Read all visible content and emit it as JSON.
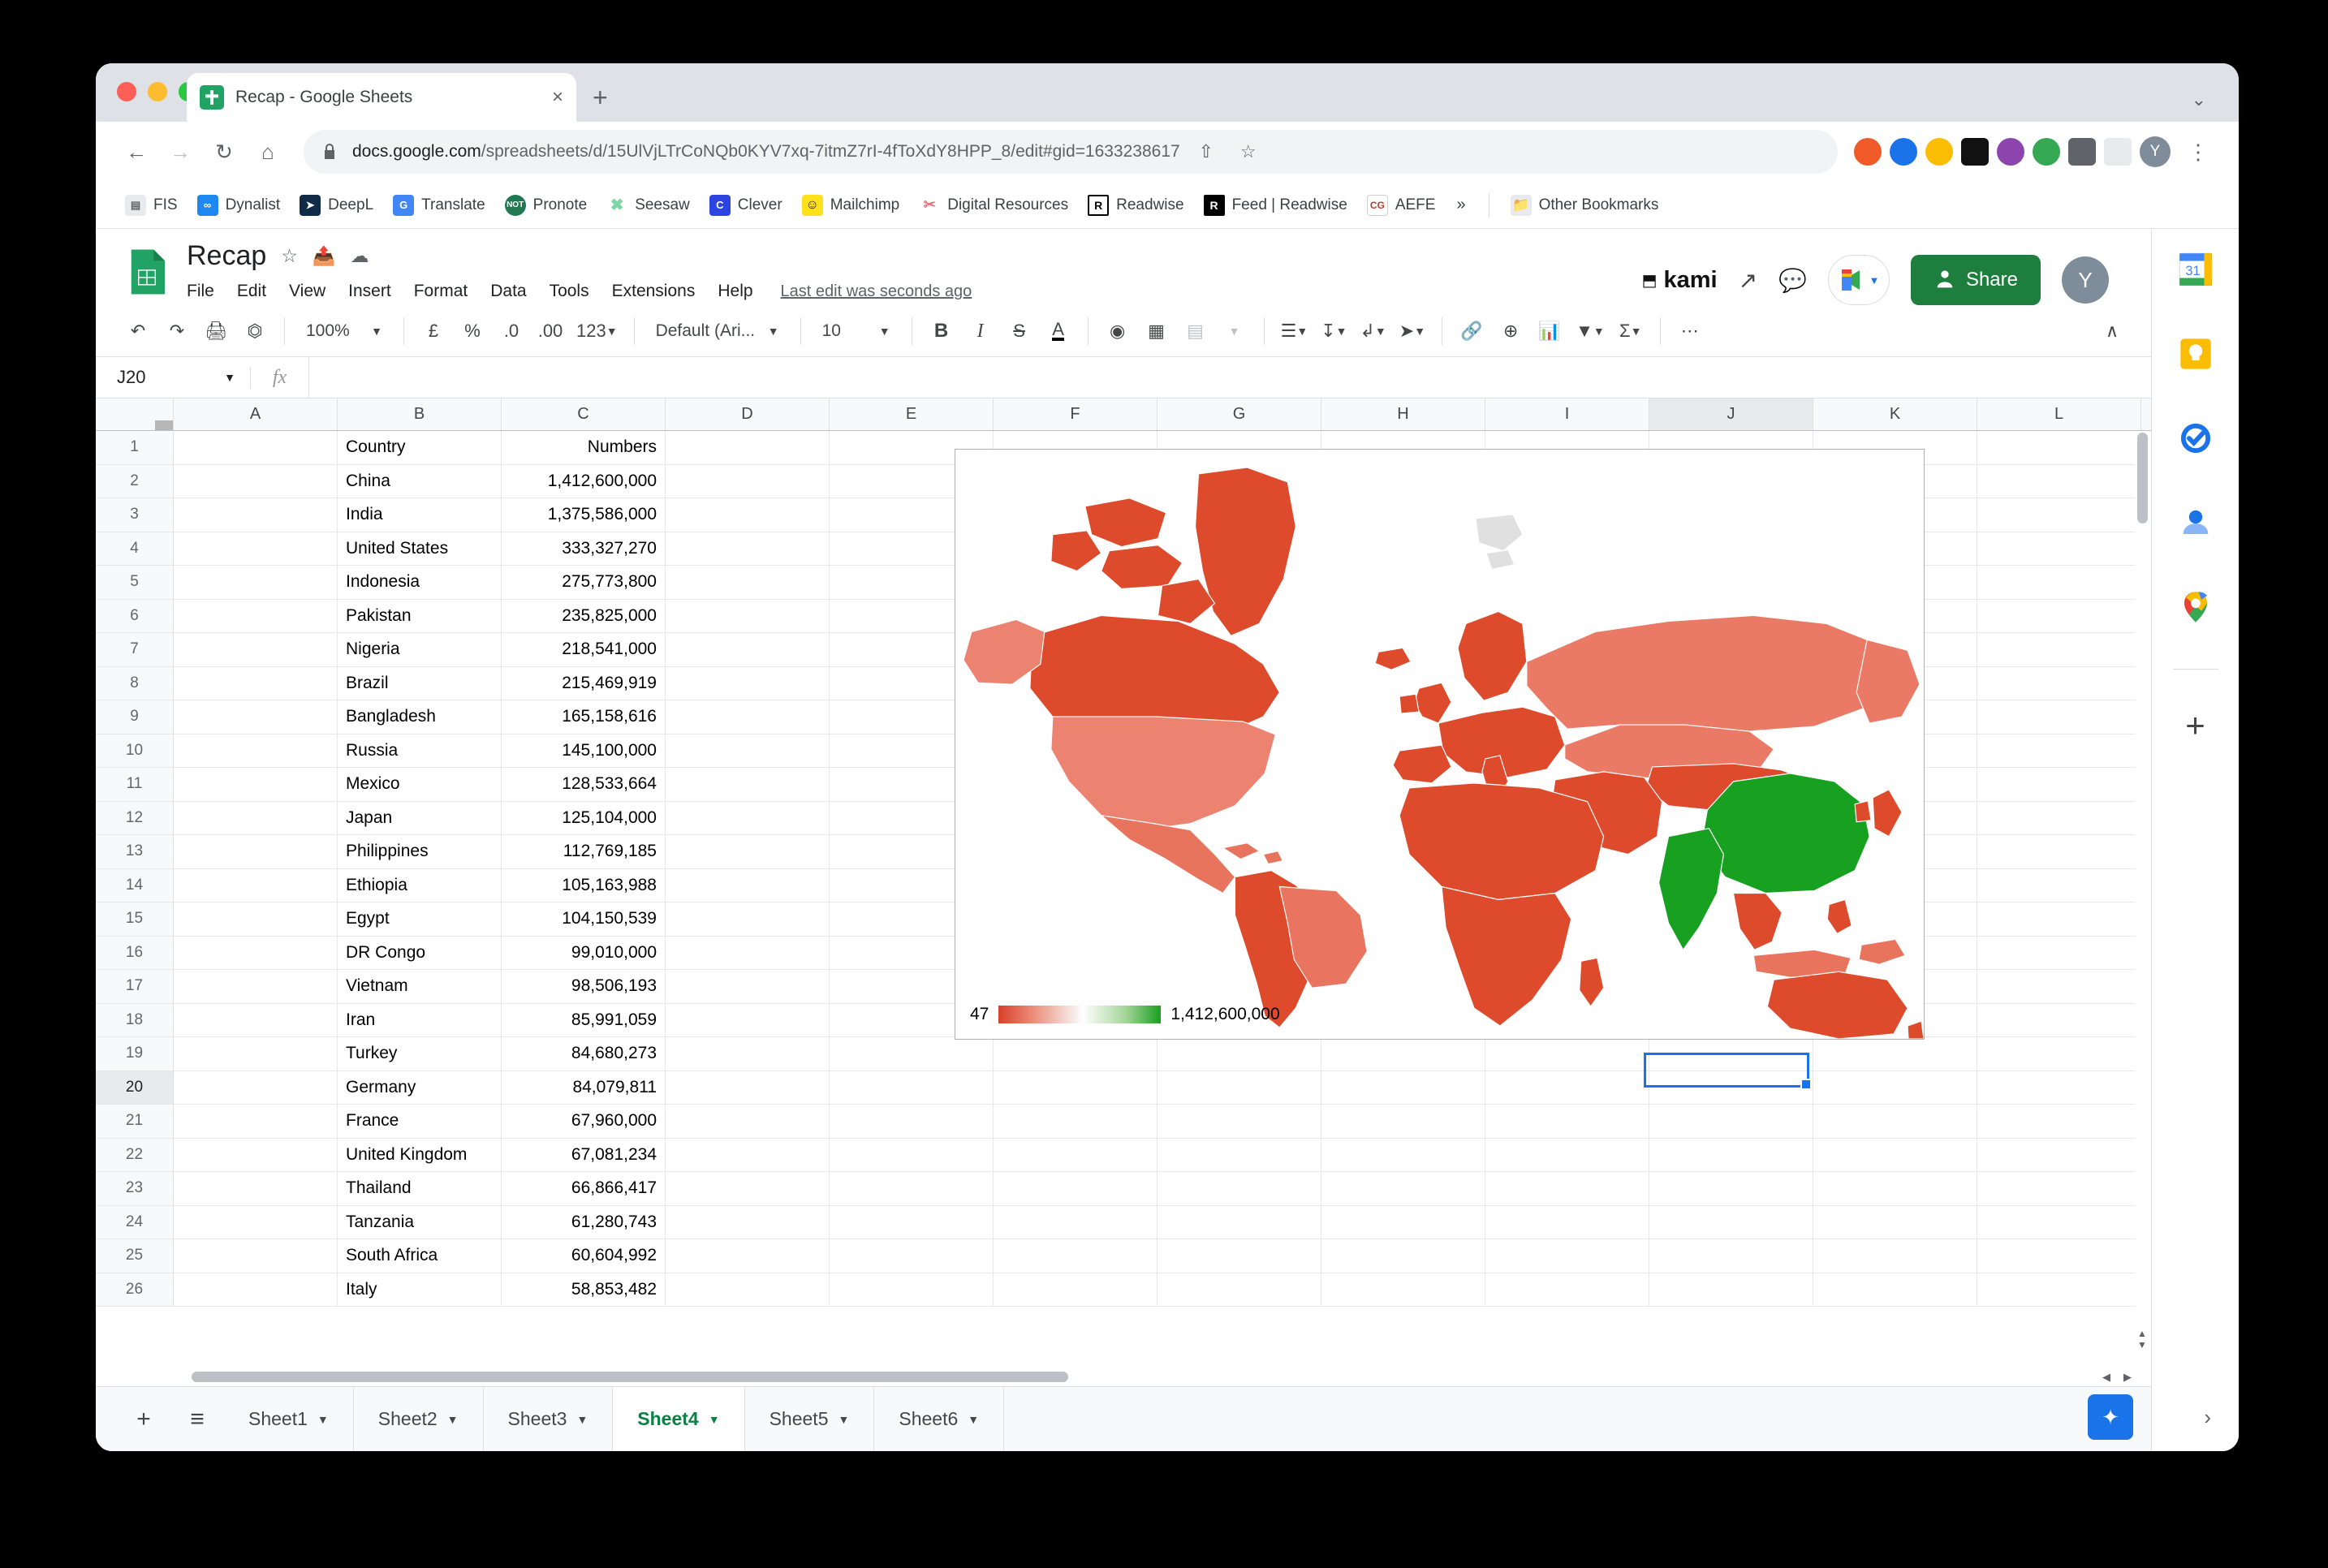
{
  "browser": {
    "tab": {
      "title": "Recap - Google Sheets",
      "favicon": "sheets-icon",
      "close": "×"
    },
    "new_tab_label": "+",
    "tab_list_chevron": "⌄",
    "nav": {
      "back": "←",
      "forward": "→",
      "reload": "↻",
      "home": "⌂"
    },
    "omnibox": {
      "lock": "lock-icon",
      "url_domain": "docs.google.com",
      "url_path": "/spreadsheets/d/15UlVjLTrCoNQb0KYV7xq-7itmZ7rI-4fToXdY8HPP_8/edit#gid=1633238617",
      "share": "share-icon",
      "bookmark": "star-icon"
    },
    "profile_initial": "Y",
    "bookmarks": [
      {
        "label": "FIS",
        "glyph": "▤",
        "bg": "#e8eaed",
        "fg": "#5f6368"
      },
      {
        "label": "Dynalist",
        "glyph": "∞",
        "bg": "#1e88f0",
        "fg": "#ffffff"
      },
      {
        "label": "DeepL",
        "glyph": "➤",
        "bg": "#0f2b46",
        "fg": "#ffffff"
      },
      {
        "label": "Translate",
        "glyph": "G",
        "bg": "#4285f4",
        "fg": "#ffffff"
      },
      {
        "label": "Pronote",
        "glyph": "NOT",
        "bg": "#1f7a52",
        "fg": "#ffffff"
      },
      {
        "label": "Seesaw",
        "glyph": "✖",
        "bg": "#7ed6a5",
        "fg": "#ffffff"
      },
      {
        "label": "Clever",
        "glyph": "C",
        "bg": "#2c44e0",
        "fg": "#ffffff"
      },
      {
        "label": "Mailchimp",
        "glyph": "☺",
        "bg": "#ffe01b",
        "fg": "#241c15"
      },
      {
        "label": "Digital Resources",
        "glyph": "✂",
        "bg": "#ffffff",
        "fg": "#e57373"
      },
      {
        "label": "Readwise",
        "glyph": "R",
        "bg": "#ffffff",
        "fg": "#000000"
      },
      {
        "label": "Feed | Readwise",
        "glyph": "R",
        "bg": "#000000",
        "fg": "#ffffff"
      },
      {
        "label": "AEFE",
        "glyph": "CG",
        "bg": "#ffffff",
        "fg": "#c0392b"
      }
    ],
    "bookmarks_overflow": "»",
    "other_bookmarks": {
      "label": "Other Bookmarks",
      "glyph": "folder-icon"
    }
  },
  "sheets": {
    "doc_title": "Recap",
    "title_icons": [
      "star-icon",
      "move-to-folder-icon",
      "cloud-saved-icon"
    ],
    "menus": [
      "File",
      "Edit",
      "View",
      "Insert",
      "Format",
      "Data",
      "Tools",
      "Extensions",
      "Help"
    ],
    "last_edit": "Last edit was seconds ago",
    "kami_label": "kami",
    "header_icons": [
      "trending-up-icon",
      "comment-icon",
      "meet-icon"
    ],
    "share_label": "Share",
    "avatar_initial": "Y",
    "toolbar": {
      "zoom": "100%",
      "font": "Default (Ari...",
      "font_size": "10",
      "currency": "£",
      "percent": "%",
      "dec_decrease": ".0",
      "dec_increase": ".00",
      "number_format": "123",
      "bold": "B",
      "italic": "I",
      "strike": "S",
      "text_color": "A",
      "more": "⋯",
      "collapse": "∧"
    },
    "name_box": "J20",
    "formula_value": "",
    "columns": [
      "A",
      "B",
      "C",
      "D",
      "E",
      "F",
      "G",
      "H",
      "I",
      "J",
      "K",
      "L"
    ],
    "selected_column": "J",
    "selected_row": "20",
    "rows": [
      {
        "n": "1",
        "b": "Country",
        "c": "Numbers"
      },
      {
        "n": "2",
        "b": "China",
        "c": "1,412,600,000"
      },
      {
        "n": "3",
        "b": "India",
        "c": "1,375,586,000"
      },
      {
        "n": "4",
        "b": "United States",
        "c": "333,327,270"
      },
      {
        "n": "5",
        "b": "Indonesia",
        "c": "275,773,800"
      },
      {
        "n": "6",
        "b": "Pakistan",
        "c": "235,825,000"
      },
      {
        "n": "7",
        "b": "Nigeria",
        "c": "218,541,000"
      },
      {
        "n": "8",
        "b": "Brazil",
        "c": "215,469,919"
      },
      {
        "n": "9",
        "b": "Bangladesh",
        "c": "165,158,616"
      },
      {
        "n": "10",
        "b": "Russia",
        "c": "145,100,000"
      },
      {
        "n": "11",
        "b": "Mexico",
        "c": "128,533,664"
      },
      {
        "n": "12",
        "b": "Japan",
        "c": "125,104,000"
      },
      {
        "n": "13",
        "b": "Philippines",
        "c": "112,769,185"
      },
      {
        "n": "14",
        "b": "Ethiopia",
        "c": "105,163,988"
      },
      {
        "n": "15",
        "b": "Egypt",
        "c": "104,150,539"
      },
      {
        "n": "16",
        "b": "DR Congo",
        "c": "99,010,000"
      },
      {
        "n": "17",
        "b": "Vietnam",
        "c": "98,506,193"
      },
      {
        "n": "18",
        "b": "Iran",
        "c": "85,991,059"
      },
      {
        "n": "19",
        "b": "Turkey",
        "c": "84,680,273"
      },
      {
        "n": "20",
        "b": "Germany",
        "c": "84,079,811"
      },
      {
        "n": "21",
        "b": "France",
        "c": "67,960,000"
      },
      {
        "n": "22",
        "b": "United Kingdom",
        "c": "67,081,234"
      },
      {
        "n": "23",
        "b": "Thailand",
        "c": "66,866,417"
      },
      {
        "n": "24",
        "b": "Tanzania",
        "c": "61,280,743"
      },
      {
        "n": "25",
        "b": "South Africa",
        "c": "60,604,992"
      },
      {
        "n": "26",
        "b": "Italy",
        "c": "58,853,482"
      }
    ],
    "sheet_tabs": [
      {
        "label": "Sheet1",
        "active": false
      },
      {
        "label": "Sheet2",
        "active": false
      },
      {
        "label": "Sheet3",
        "active": false
      },
      {
        "label": "Sheet4",
        "active": true
      },
      {
        "label": "Sheet5",
        "active": false
      },
      {
        "label": "Sheet6",
        "active": false
      }
    ],
    "add_sheet": "+",
    "all_sheets": "≡",
    "explore": "✦",
    "side_rail": [
      "calendar-icon",
      "keep-icon",
      "tasks-icon",
      "contacts-icon",
      "maps-icon",
      "add-addon-icon"
    ],
    "rail_expand": "›"
  },
  "chart_data": {
    "type": "map",
    "title": "",
    "legend": {
      "min": "47",
      "max": "1,412,600,000",
      "gradient_low": "#d8402a",
      "gradient_mid": "#ffffff",
      "gradient_high": "#18a020"
    },
    "value_column": "Numbers",
    "region_column": "Country",
    "highlighted_regions": [
      {
        "name": "China",
        "value": "1,412,600,000",
        "color": "#18a020"
      },
      {
        "name": "India",
        "value": "1,375,586,000",
        "color": "#18a020"
      },
      {
        "name": "United States",
        "value": "333,327,270",
        "color": "#ec8370"
      },
      {
        "name": "Russia",
        "value": "145,100,000",
        "color": "#ea7a65"
      },
      {
        "name": "Brazil",
        "value": "215,469,919",
        "color": "#e9745f"
      }
    ],
    "default_color": "#dd4b2c",
    "no_data_color": "#e0e0e0"
  }
}
